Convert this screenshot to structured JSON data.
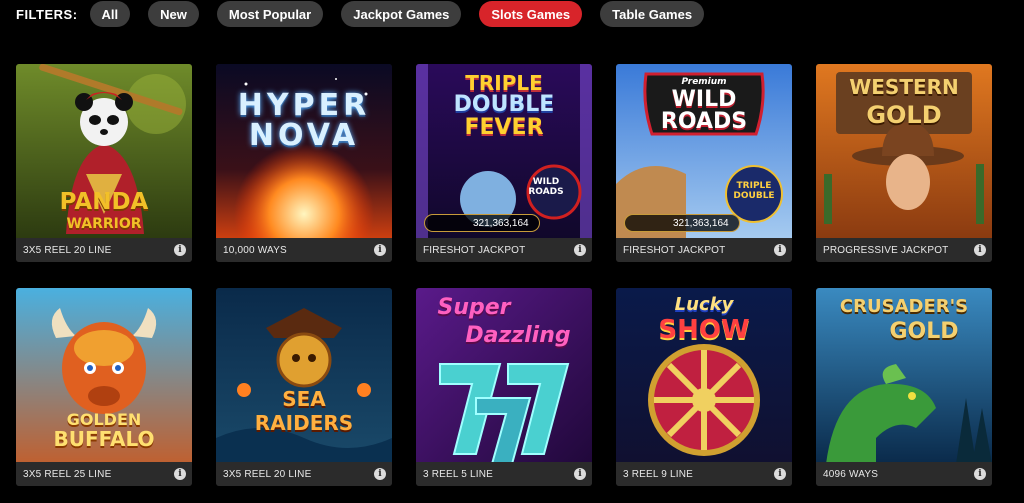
{
  "filters": {
    "label": "FILTERS:",
    "items": [
      {
        "label": "All",
        "active": false
      },
      {
        "label": "New",
        "active": false
      },
      {
        "label": "Most Popular",
        "active": false
      },
      {
        "label": "Jackpot Games",
        "active": false
      },
      {
        "label": "Slots Games",
        "active": true
      },
      {
        "label": "Table Games",
        "active": false
      }
    ]
  },
  "games": [
    {
      "title_lines": [
        "PANDA",
        "WARRIOR"
      ],
      "tag": "3X5 REEL 20 LINE"
    },
    {
      "title_lines": [
        "HYPER",
        "NOVA"
      ],
      "tag": "10,000 WAYS"
    },
    {
      "title_lines": [
        "TRIPLE",
        "DOUBLE",
        "FEVER"
      ],
      "badge": [
        "WILD",
        "ROADS"
      ],
      "tag": "FIRESHOT JACKPOT",
      "jackpot": "321,363,164"
    },
    {
      "title_lines": [
        "Premium",
        "WILD",
        "ROADS"
      ],
      "badge": [
        "TRIPLE",
        "DOUBLE"
      ],
      "tag": "FIRESHOT JACKPOT",
      "jackpot": "321,363,164"
    },
    {
      "title_lines": [
        "WESTERN",
        "GOLD"
      ],
      "tag": "PROGRESSIVE JACKPOT"
    },
    {
      "title_lines": [
        "GOLDEN",
        "BUFFALO"
      ],
      "tag": "3X5 REEL 25 LINE"
    },
    {
      "title_lines": [
        "SEA",
        "RAIDERS"
      ],
      "tag": "3X5 REEL 20 LINE"
    },
    {
      "title_lines": [
        "Super",
        "Dazzling"
      ],
      "tag": "3 REEL 5 LINE"
    },
    {
      "title_lines": [
        "Lucky",
        "SHOW"
      ],
      "tag": "3 REEL 9 LINE"
    },
    {
      "title_lines": [
        "CRUSADER'S",
        "GOLD"
      ],
      "tag": "4096 WAYS"
    }
  ],
  "info_glyph": "i",
  "colors": {
    "active_filter": "#d8242a",
    "filter_bg": "#3d3d3d",
    "card_bar": "#2b2b2b"
  }
}
